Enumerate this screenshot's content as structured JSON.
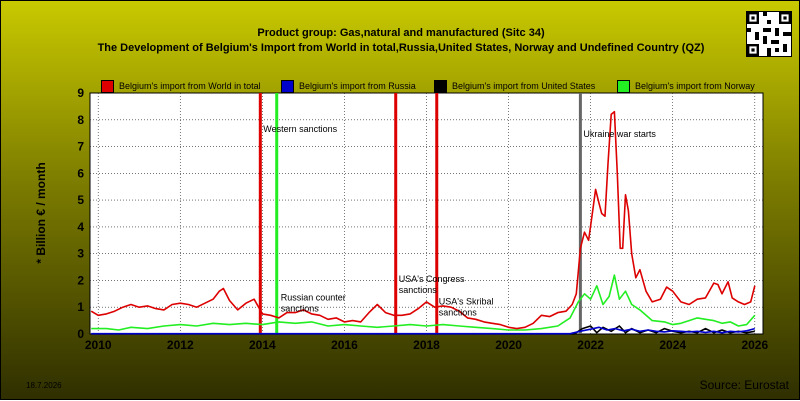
{
  "header": {
    "title_line1": "Product group: Gas,natural and manufactured (Sitc 34)",
    "title_line2": "The Development of Belgium's Import from World in total,Russia,United States, Norway and Undefined Country (QZ)"
  },
  "footer": {
    "date": "18.7.2026",
    "source": "Source: Eurostat"
  },
  "colors": {
    "world": "#dd0000",
    "russia": "#0000cc",
    "united_states": "#000000",
    "norway": "#22ee22",
    "plot_bg": "#ffffff",
    "grid": "#222222",
    "event_red": "#dd0000",
    "event_green": "#22ee22",
    "event_gray": "#666666"
  },
  "chart_data": {
    "type": "line",
    "ylabel": "* Billion € / month",
    "xlabel": "",
    "xlim": [
      2009.8,
      2026.2
    ],
    "ylim": [
      0,
      9
    ],
    "xticks": [
      2010,
      2012,
      2014,
      2016,
      2018,
      2020,
      2022,
      2024,
      2026
    ],
    "yticks": [
      0,
      1,
      2,
      3,
      4,
      5,
      6,
      7,
      8,
      9
    ],
    "grid": true,
    "legend_position": "top",
    "series": [
      {
        "name": "Belgium's import from World in total",
        "color": "#dd0000",
        "points": [
          [
            2009.83,
            0.85
          ],
          [
            2010.0,
            0.7
          ],
          [
            2010.2,
            0.75
          ],
          [
            2010.4,
            0.85
          ],
          [
            2010.6,
            1.0
          ],
          [
            2010.8,
            1.1
          ],
          [
            2011.0,
            1.0
          ],
          [
            2011.2,
            1.05
          ],
          [
            2011.4,
            0.95
          ],
          [
            2011.6,
            0.9
          ],
          [
            2011.8,
            1.1
          ],
          [
            2012.0,
            1.15
          ],
          [
            2012.2,
            1.1
          ],
          [
            2012.4,
            1.0
          ],
          [
            2012.6,
            1.15
          ],
          [
            2012.8,
            1.3
          ],
          [
            2012.95,
            1.6
          ],
          [
            2013.05,
            1.7
          ],
          [
            2013.2,
            1.25
          ],
          [
            2013.4,
            0.9
          ],
          [
            2013.6,
            1.15
          ],
          [
            2013.8,
            1.3
          ],
          [
            2014.0,
            0.75
          ],
          [
            2014.2,
            0.7
          ],
          [
            2014.4,
            0.6
          ],
          [
            2014.6,
            0.8
          ],
          [
            2014.8,
            0.8
          ],
          [
            2015.0,
            0.9
          ],
          [
            2015.2,
            0.75
          ],
          [
            2015.4,
            0.7
          ],
          [
            2015.6,
            0.55
          ],
          [
            2015.8,
            0.6
          ],
          [
            2016.0,
            0.45
          ],
          [
            2016.2,
            0.5
          ],
          [
            2016.4,
            0.45
          ],
          [
            2016.6,
            0.8
          ],
          [
            2016.8,
            1.1
          ],
          [
            2017.0,
            0.8
          ],
          [
            2017.2,
            0.7
          ],
          [
            2017.4,
            0.7
          ],
          [
            2017.6,
            0.75
          ],
          [
            2017.8,
            0.95
          ],
          [
            2018.0,
            1.2
          ],
          [
            2018.2,
            1.0
          ],
          [
            2018.4,
            1.05
          ],
          [
            2018.6,
            1.0
          ],
          [
            2018.8,
            0.85
          ],
          [
            2019.0,
            0.6
          ],
          [
            2019.2,
            0.55
          ],
          [
            2019.4,
            0.45
          ],
          [
            2019.6,
            0.4
          ],
          [
            2019.8,
            0.35
          ],
          [
            2020.0,
            0.25
          ],
          [
            2020.2,
            0.2
          ],
          [
            2020.4,
            0.25
          ],
          [
            2020.6,
            0.4
          ],
          [
            2020.8,
            0.7
          ],
          [
            2021.0,
            0.65
          ],
          [
            2021.2,
            0.8
          ],
          [
            2021.4,
            0.85
          ],
          [
            2021.55,
            1.1
          ],
          [
            2021.65,
            1.5
          ],
          [
            2021.75,
            3.2
          ],
          [
            2021.85,
            3.8
          ],
          [
            2021.95,
            3.5
          ],
          [
            2022.05,
            4.6
          ],
          [
            2022.12,
            5.4
          ],
          [
            2022.2,
            4.9
          ],
          [
            2022.27,
            4.5
          ],
          [
            2022.35,
            4.4
          ],
          [
            2022.42,
            6.3
          ],
          [
            2022.5,
            8.2
          ],
          [
            2022.58,
            8.3
          ],
          [
            2022.65,
            6.0
          ],
          [
            2022.72,
            3.2
          ],
          [
            2022.78,
            3.2
          ],
          [
            2022.85,
            5.2
          ],
          [
            2022.92,
            4.6
          ],
          [
            2023.0,
            3.0
          ],
          [
            2023.1,
            2.1
          ],
          [
            2023.2,
            2.4
          ],
          [
            2023.35,
            1.6
          ],
          [
            2023.5,
            1.2
          ],
          [
            2023.7,
            1.3
          ],
          [
            2023.85,
            1.75
          ],
          [
            2024.0,
            1.6
          ],
          [
            2024.2,
            1.2
          ],
          [
            2024.4,
            1.1
          ],
          [
            2024.6,
            1.3
          ],
          [
            2024.8,
            1.35
          ],
          [
            2025.0,
            1.9
          ],
          [
            2025.1,
            1.85
          ],
          [
            2025.2,
            1.5
          ],
          [
            2025.35,
            1.95
          ],
          [
            2025.45,
            1.35
          ],
          [
            2025.6,
            1.2
          ],
          [
            2025.75,
            1.1
          ],
          [
            2025.9,
            1.2
          ],
          [
            2026.0,
            1.8
          ]
        ]
      },
      {
        "name": "Belgium's import from Russia",
        "color": "#0000cc",
        "points": [
          [
            2009.83,
            0.01
          ],
          [
            2021.5,
            0.01
          ],
          [
            2021.6,
            0.05
          ],
          [
            2021.8,
            0.12
          ],
          [
            2022.0,
            0.18
          ],
          [
            2022.2,
            0.25
          ],
          [
            2022.4,
            0.15
          ],
          [
            2022.6,
            0.2
          ],
          [
            2022.8,
            0.12
          ],
          [
            2023.0,
            0.18
          ],
          [
            2023.2,
            0.1
          ],
          [
            2023.4,
            0.15
          ],
          [
            2023.6,
            0.1
          ],
          [
            2023.8,
            0.08
          ],
          [
            2024.0,
            0.12
          ],
          [
            2024.2,
            0.1
          ],
          [
            2024.4,
            0.08
          ],
          [
            2024.6,
            0.1
          ],
          [
            2024.8,
            0.06
          ],
          [
            2025.0,
            0.1
          ],
          [
            2025.2,
            0.05
          ],
          [
            2025.4,
            0.1
          ],
          [
            2025.6,
            0.08
          ],
          [
            2025.8,
            0.12
          ],
          [
            2026.0,
            0.2
          ]
        ]
      },
      {
        "name": "Belgium's import from United States",
        "color": "#000000",
        "points": [
          [
            2009.83,
            0.0
          ],
          [
            2021.6,
            0.0
          ],
          [
            2021.8,
            0.2
          ],
          [
            2022.0,
            0.3
          ],
          [
            2022.15,
            0.05
          ],
          [
            2022.3,
            0.25
          ],
          [
            2022.5,
            0.1
          ],
          [
            2022.7,
            0.3
          ],
          [
            2022.85,
            0.05
          ],
          [
            2023.0,
            0.2
          ],
          [
            2023.2,
            0.05
          ],
          [
            2023.4,
            0.15
          ],
          [
            2023.6,
            0.05
          ],
          [
            2023.8,
            0.2
          ],
          [
            2024.0,
            0.1
          ],
          [
            2024.2,
            0.05
          ],
          [
            2024.4,
            0.1
          ],
          [
            2024.6,
            0.05
          ],
          [
            2024.8,
            0.2
          ],
          [
            2025.0,
            0.05
          ],
          [
            2025.2,
            0.15
          ],
          [
            2025.4,
            0.05
          ],
          [
            2025.6,
            0.1
          ],
          [
            2025.8,
            0.05
          ],
          [
            2026.0,
            0.1
          ]
        ]
      },
      {
        "name": "Belgium's import from Norway",
        "color": "#22ee22",
        "points": [
          [
            2009.83,
            0.2
          ],
          [
            2010.2,
            0.2
          ],
          [
            2010.5,
            0.15
          ],
          [
            2010.8,
            0.25
          ],
          [
            2011.2,
            0.2
          ],
          [
            2011.6,
            0.3
          ],
          [
            2012.0,
            0.35
          ],
          [
            2012.4,
            0.3
          ],
          [
            2012.8,
            0.4
          ],
          [
            2013.2,
            0.35
          ],
          [
            2013.6,
            0.4
          ],
          [
            2014.0,
            0.35
          ],
          [
            2014.4,
            0.45
          ],
          [
            2014.8,
            0.4
          ],
          [
            2015.2,
            0.45
          ],
          [
            2015.6,
            0.3
          ],
          [
            2016.0,
            0.35
          ],
          [
            2016.4,
            0.3
          ],
          [
            2016.8,
            0.25
          ],
          [
            2017.2,
            0.3
          ],
          [
            2017.6,
            0.35
          ],
          [
            2018.0,
            0.3
          ],
          [
            2018.4,
            0.35
          ],
          [
            2018.8,
            0.3
          ],
          [
            2019.2,
            0.25
          ],
          [
            2019.6,
            0.2
          ],
          [
            2020.0,
            0.15
          ],
          [
            2020.4,
            0.15
          ],
          [
            2020.8,
            0.2
          ],
          [
            2021.2,
            0.3
          ],
          [
            2021.5,
            0.6
          ],
          [
            2021.7,
            1.2
          ],
          [
            2021.85,
            1.5
          ],
          [
            2022.0,
            1.3
          ],
          [
            2022.15,
            1.8
          ],
          [
            2022.3,
            1.1
          ],
          [
            2022.45,
            1.4
          ],
          [
            2022.58,
            2.2
          ],
          [
            2022.7,
            1.3
          ],
          [
            2022.85,
            1.6
          ],
          [
            2023.0,
            1.1
          ],
          [
            2023.2,
            0.9
          ],
          [
            2023.5,
            0.5
          ],
          [
            2023.8,
            0.45
          ],
          [
            2024.0,
            0.35
          ],
          [
            2024.2,
            0.4
          ],
          [
            2024.4,
            0.5
          ],
          [
            2024.6,
            0.6
          ],
          [
            2024.8,
            0.55
          ],
          [
            2025.0,
            0.5
          ],
          [
            2025.2,
            0.4
          ],
          [
            2025.4,
            0.45
          ],
          [
            2025.6,
            0.3
          ],
          [
            2025.8,
            0.35
          ],
          [
            2026.0,
            0.7
          ]
        ]
      }
    ],
    "events": [
      {
        "date": 2013.95,
        "color": "#dd0000",
        "label": "Western sanctions",
        "label_y": 7.55
      },
      {
        "date": 2014.35,
        "color": "#22ee22",
        "label": "",
        "label_y": null
      },
      {
        "date": 2017.25,
        "color": "#dd0000",
        "label": "USA's Congress\nsanctions",
        "label_y": 1.95
      },
      {
        "date": 2018.25,
        "color": "#dd0000",
        "label": "",
        "label_y": null
      },
      {
        "date": 2021.75,
        "color": "#666666",
        "label": "Ukraine war starts",
        "label_y": 7.35
      }
    ],
    "annotations": [
      {
        "text": "Russian counter\nsanctions",
        "x": 2014.4,
        "y": 1.25
      },
      {
        "text": "USA's Skribal\nsanctions",
        "x": 2018.25,
        "y": 1.1
      }
    ]
  }
}
